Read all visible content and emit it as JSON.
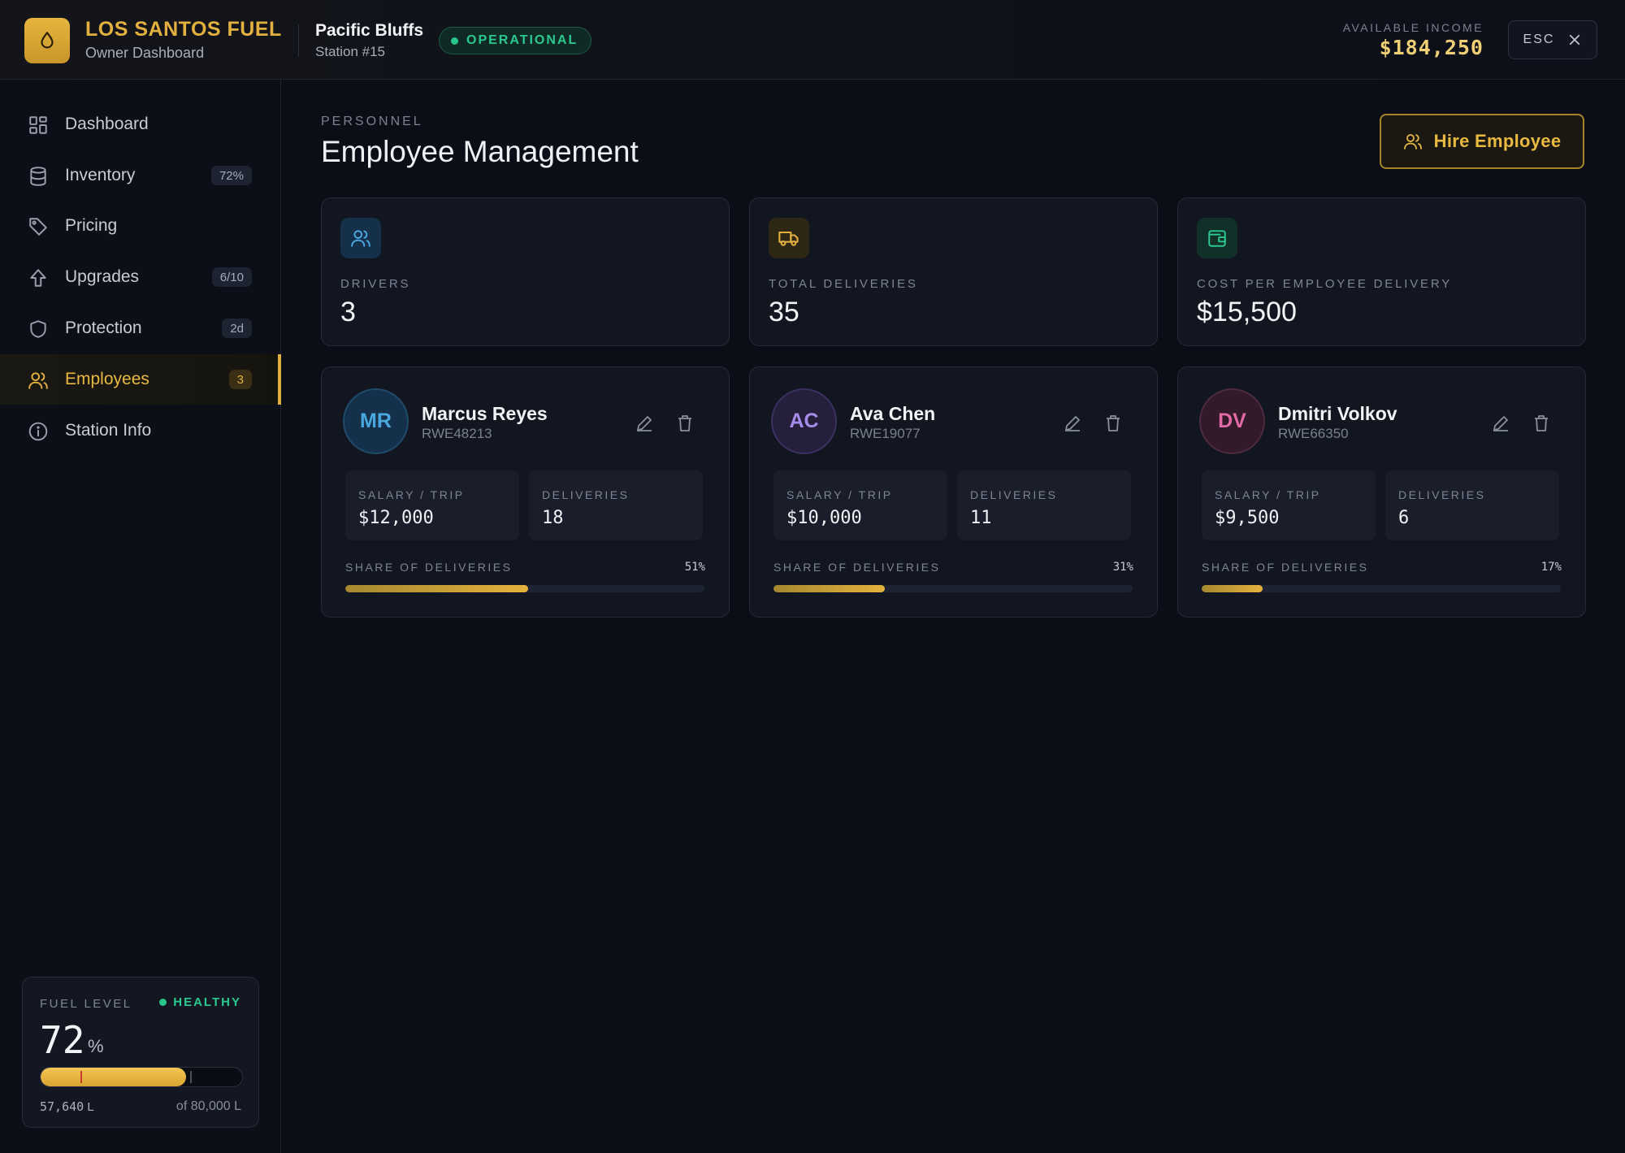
{
  "header": {
    "brand_title": "LOS SANTOS FUEL",
    "brand_subtitle": "Owner Dashboard",
    "station_name": "Pacific Bluffs",
    "station_number": "Station #15",
    "status": "OPERATIONAL",
    "income_label": "AVAILABLE INCOME",
    "income_value": "$184,250",
    "esc_label": "ESC"
  },
  "sidebar": {
    "items": [
      {
        "label": "Dashboard",
        "badge": "",
        "icon": "grid-icon"
      },
      {
        "label": "Inventory",
        "badge": "72%",
        "icon": "database-icon"
      },
      {
        "label": "Pricing",
        "badge": "",
        "icon": "tag-icon"
      },
      {
        "label": "Upgrades",
        "badge": "6/10",
        "icon": "arrow-up-icon"
      },
      {
        "label": "Protection",
        "badge": "2d",
        "icon": "shield-icon"
      },
      {
        "label": "Employees",
        "badge": "3",
        "icon": "users-icon",
        "active": true
      },
      {
        "label": "Station Info",
        "badge": "",
        "icon": "info-icon"
      }
    ],
    "fuel": {
      "label": "FUEL LEVEL",
      "status": "HEALTHY",
      "percent": "72",
      "percent_unit": "%",
      "level_fraction": 0.72,
      "current": "57,640",
      "current_unit": "L",
      "capacity": "of 80,000 L"
    }
  },
  "main": {
    "eyebrow": "PERSONNEL",
    "title": "Employee Management",
    "hire_label": "Hire Employee",
    "stats": [
      {
        "label": "DRIVERS",
        "value": "3",
        "icon": "users-icon"
      },
      {
        "label": "TOTAL DELIVERIES",
        "value": "35",
        "icon": "truck-icon"
      },
      {
        "label": "COST PER EMPLOYEE DELIVERY",
        "value": "$15,500",
        "icon": "wallet-icon"
      }
    ],
    "employees": [
      {
        "initials": "MR",
        "name": "Marcus Reyes",
        "id": "RWE48213",
        "salary_label": "SALARY / TRIP",
        "salary": "$12,000",
        "deliveries_label": "DELIVERIES",
        "deliveries": "18",
        "share_label": "SHARE OF DELIVERIES",
        "share_pct": "51%",
        "share_fraction": 0.51
      },
      {
        "initials": "AC",
        "name": "Ava Chen",
        "id": "RWE19077",
        "salary_label": "SALARY / TRIP",
        "salary": "$10,000",
        "deliveries_label": "DELIVERIES",
        "deliveries": "11",
        "share_label": "SHARE OF DELIVERIES",
        "share_pct": "31%",
        "share_fraction": 0.31
      },
      {
        "initials": "DV",
        "name": "Dmitri Volkov",
        "id": "RWE66350",
        "salary_label": "SALARY / TRIP",
        "salary": "$9,500",
        "deliveries_label": "DELIVERIES",
        "deliveries": "6",
        "share_label": "SHARE OF DELIVERIES",
        "share_pct": "17%",
        "share_fraction": 0.17
      }
    ]
  },
  "colors": {
    "accent": "#e2b03f",
    "success": "#2bc98f",
    "background": "#0b0e16",
    "avatar_mr": "#4aa8e0",
    "avatar_ac": "#a58ce8",
    "avatar_dv": "#e26aa6"
  }
}
